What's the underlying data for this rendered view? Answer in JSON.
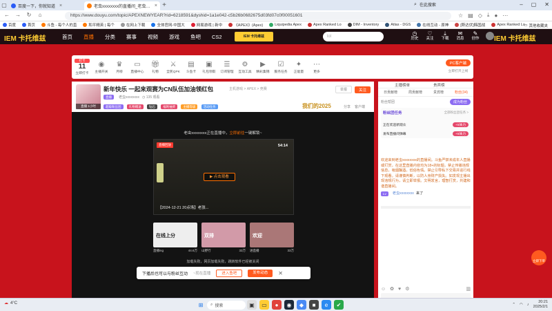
{
  "browser": {
    "tabs": [
      {
        "label": "百度一下，你就知道",
        "color": "#2b5cf6",
        "active": false
      },
      {
        "label": "老虫xxxxxxxx的直播间_老虫xxxxxxxx直播_斗鱼直播",
        "color": "#ff7a00",
        "active": true
      }
    ],
    "new_tab": "+",
    "url": "https://www.douyu.com/topic/APEXNEWYEAR?rid=6218591&dyshid=1a1e042-c5b26b0682675d03fd07c0f00051601",
    "search_label": "在此搜索",
    "bookmarks": [
      {
        "label": "百度",
        "color": "#2b5cf6"
      },
      {
        "label": "首页",
        "color": "#2b5cf6"
      },
      {
        "label": "斗鱼 - 每个人的直",
        "color": "#ff7a00"
      },
      {
        "label": "和平精英 | 每个",
        "color": "#ff7a00"
      },
      {
        "label": "在网上下载",
        "color": "#999"
      },
      {
        "label": "全体官网-中国大",
        "color": "#1a73e8"
      },
      {
        "label": "网易游戏 | 新中",
        "color": "#d23"
      },
      {
        "label": "《APEX》(Apex)",
        "color": "#c33"
      },
      {
        "label": "Liquipedia Apex",
        "color": "#3a6"
      },
      {
        "label": "Apex Ranked Lo",
        "color": "#c33"
      },
      {
        "label": "DIM - Inventory",
        "color": "#444"
      },
      {
        "label": "Atlas - DGS",
        "color": "#357"
      },
      {
        "label": "在线互动 - 原神",
        "color": "#47a"
      },
      {
        "label": "[斯达伏]韩国战",
        "color": "#c44"
      },
      {
        "label": "Apex Ranked Lo",
        "color": "#c33"
      }
    ],
    "other_bookmarks": "其他收藏夹"
  },
  "site": {
    "logo": "IEM 卡托维兹",
    "nav": [
      "首页",
      "直播",
      "分类",
      "赛事",
      "视频",
      "游戏",
      "鱼吧",
      "CS2"
    ],
    "event_badge": "IEM 卡托维兹",
    "search_placeholder": "lol",
    "header_icons": [
      "历史",
      "关注",
      "下载",
      "消息",
      "创作"
    ],
    "right_logo": "IEM 卡托维兹"
  },
  "ribbon": {
    "date_badge": "11",
    "date_label": "立即打卡",
    "items": [
      "主播开关",
      "月榜",
      "直播中心",
      "礼物",
      "全民QPK",
      "斗鱼卡",
      "礼包领取",
      "订阅管理",
      "互动工具",
      "精彩集锦",
      "服务任务",
      "正能量",
      "更多"
    ],
    "right_button": "PC客户端",
    "right_sub": "立即打开上线"
  },
  "stream": {
    "title": "新年快乐 一起来观赛为CN队伍加油领红包",
    "host_label": "老虫xxxxxxxx",
    "category": "主机游戏 > APEX > 竞赛",
    "tags": [
      "超级粉丝团",
      "礼物赠送",
      "钻石",
      "福利抽奖",
      "主播等级",
      "活动任务"
    ],
    "follow": "关注",
    "report": "举报",
    "share": "分享",
    "client": "客户端",
    "banner": "我们的2025"
  },
  "player": {
    "notice_prefix": "老虫xxxxxxxx正在直播中，",
    "notice_link": "立即前往",
    "notice_suffix": "一键解锁~",
    "video_tag": "直播回放",
    "video_time": "54:14",
    "watch_button": "点击观看",
    "video_caption": "【2024-12-21 20点场】老张...",
    "thumbs": [
      {
        "label": "在线上分",
        "title": "直播ing",
        "views": "44.6万",
        "color": "#eeeeee"
      },
      {
        "label": "双排",
        "title": "山野行",
        "views": "33万",
        "color": "#d29aa8"
      },
      {
        "label": "欢迎",
        "title": "进直播",
        "views": "33万",
        "color": "#a77"
      }
    ],
    "load_fail": "加载失败，网页加载失败，跳转软件已经被关闭"
  },
  "popup": {
    "text": "下播后也可以与粉丝互动",
    "link": "~现在直播",
    "btn1": "进入鱼吧",
    "btn2": "发布动态"
  },
  "sidebar": {
    "tabs": [
      "主播榜单",
      "贵宾榜"
    ],
    "sub_tabs": [
      "日贡献榜",
      "周贡献榜",
      "贵宾榜",
      "粉丝(34)"
    ],
    "entry_label": "粉丝帮团",
    "entry_btn": "成为粉丝",
    "fan_title": "粉丝团任务",
    "fan_link": "全部粉丝团任务 >",
    "tasks": [
      {
        "label": "正在欢迎新观众",
        "reward": "+5体力"
      },
      {
        "label": "发布直播间弹幕",
        "reward": "+5体力"
      }
    ],
    "chat_text": "欢迎来到老虫xxxxxxxx的直播间。斗鱼严禁未成年人直播或打赏，在这里直播内容均为18+的标题，禁止传播违规信息，吸烟酗酒，低俗色情。禁止引导私下交易并进行线下观看。请谨慎判断，以防人身财产损失。如发现主播出现违规行为，请立即举报。文明发言，理智打赏，共建和谐直播间。",
    "chat_user": "老虫xxxxxxxx",
    "chat_msg": "来了",
    "float_label": "立即下单"
  },
  "taskbar": {
    "weather": "4°C",
    "search": "搜索",
    "time": "20:21",
    "date": "2025/2/1"
  }
}
